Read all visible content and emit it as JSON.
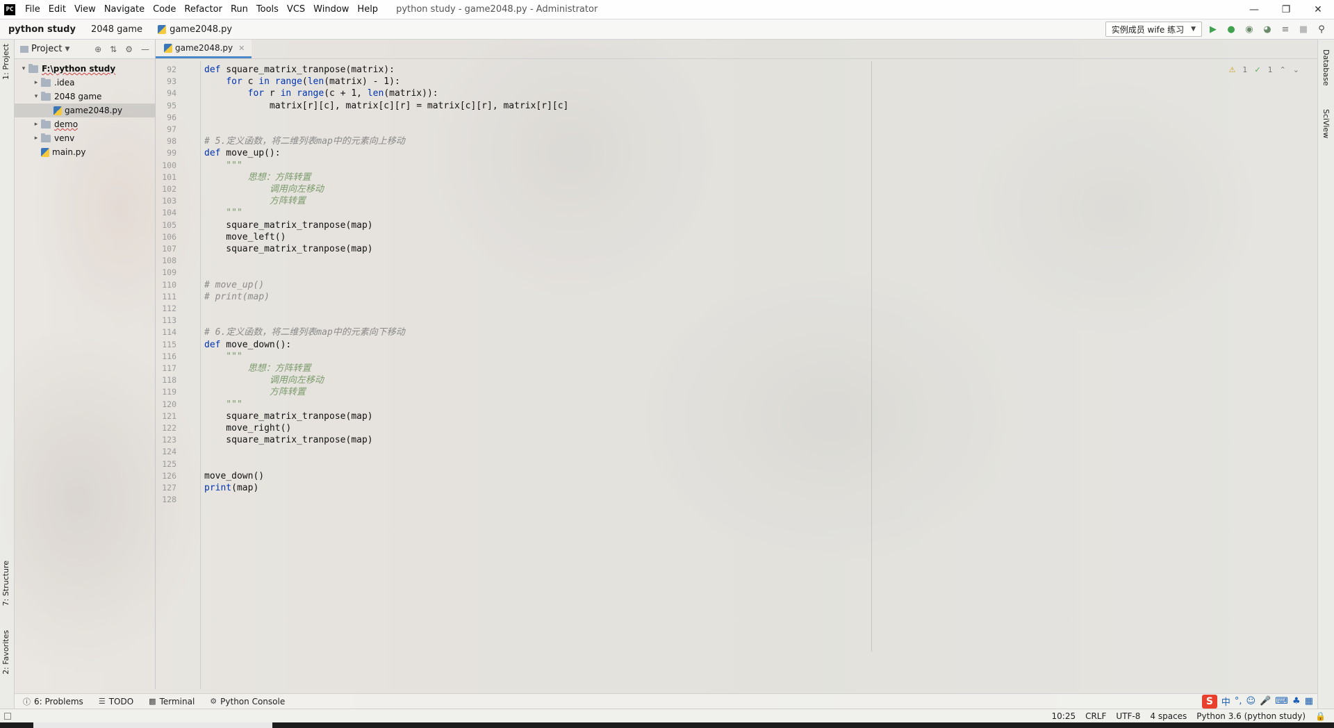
{
  "window": {
    "logo": "PC",
    "title": "python study - game2048.py - Administrator",
    "menu": [
      "File",
      "Edit",
      "View",
      "Navigate",
      "Code",
      "Refactor",
      "Run",
      "Tools",
      "VCS",
      "Window",
      "Help"
    ]
  },
  "navbar": {
    "crumbs": [
      "python study",
      "2048 game",
      "game2048.py"
    ],
    "run_config": "实例成员 wife 练习"
  },
  "left_tabs": {
    "project": "1: Project",
    "structure": "7: Structure",
    "favorites": "2: Favorites"
  },
  "project_panel": {
    "title": "Project",
    "tree": [
      {
        "label": "F:\\python study",
        "level": 0,
        "type": "folder",
        "expanded": true,
        "bold": true
      },
      {
        "label": ".idea",
        "level": 1,
        "type": "folder",
        "expanded": false
      },
      {
        "label": "2048 game",
        "level": 1,
        "type": "folder",
        "expanded": true
      },
      {
        "label": "game2048.py",
        "level": 2,
        "type": "py",
        "selected": true
      },
      {
        "label": "demo",
        "level": 1,
        "type": "folder",
        "expanded": false,
        "underline": true
      },
      {
        "label": "venv",
        "level": 1,
        "type": "folder",
        "expanded": false
      },
      {
        "label": "main.py",
        "level": 1,
        "type": "py"
      }
    ]
  },
  "editor": {
    "tab": "game2048.py",
    "inspection": {
      "warnings": "1",
      "ok": "1"
    },
    "lines": [
      {
        "n": "92",
        "t": "def square_matrix_tranpose(matrix):",
        "k": "code"
      },
      {
        "n": "93",
        "t": "    for c in range(len(matrix) - 1):",
        "k": "code"
      },
      {
        "n": "94",
        "t": "        for r in range(c + 1, len(matrix)):",
        "k": "code"
      },
      {
        "n": "95",
        "t": "            matrix[r][c], matrix[c][r] = matrix[c][r], matrix[r][c]",
        "k": "code"
      },
      {
        "n": "96",
        "t": "",
        "k": "code"
      },
      {
        "n": "97",
        "t": "",
        "k": "code"
      },
      {
        "n": "98",
        "t": "# 5.定义函数，将二维列表map中的元素向上移动",
        "k": "comment"
      },
      {
        "n": "99",
        "t": "def move_up():",
        "k": "code"
      },
      {
        "n": "100",
        "t": "    \"\"\"",
        "k": "docstr"
      },
      {
        "n": "101",
        "t": "        思想：方阵转置",
        "k": "docstr"
      },
      {
        "n": "102",
        "t": "            调用向左移动",
        "k": "docstr"
      },
      {
        "n": "103",
        "t": "            方阵转置",
        "k": "docstr"
      },
      {
        "n": "104",
        "t": "    \"\"\"",
        "k": "docstr"
      },
      {
        "n": "105",
        "t": "    square_matrix_tranpose(map)",
        "k": "code"
      },
      {
        "n": "106",
        "t": "    move_left()",
        "k": "code"
      },
      {
        "n": "107",
        "t": "    square_matrix_tranpose(map)",
        "k": "code"
      },
      {
        "n": "108",
        "t": "",
        "k": "code"
      },
      {
        "n": "109",
        "t": "",
        "k": "code"
      },
      {
        "n": "110",
        "t": "# move_up()",
        "k": "comment"
      },
      {
        "n": "111",
        "t": "# print(map)",
        "k": "comment"
      },
      {
        "n": "112",
        "t": "",
        "k": "code"
      },
      {
        "n": "113",
        "t": "",
        "k": "code"
      },
      {
        "n": "114",
        "t": "# 6.定义函数，将二维列表map中的元素向下移动",
        "k": "comment"
      },
      {
        "n": "115",
        "t": "def move_down():",
        "k": "code"
      },
      {
        "n": "116",
        "t": "    \"\"\"",
        "k": "docstr"
      },
      {
        "n": "117",
        "t": "        思想：方阵转置",
        "k": "docstr"
      },
      {
        "n": "118",
        "t": "            调用向左移动",
        "k": "docstr"
      },
      {
        "n": "119",
        "t": "            方阵转置",
        "k": "docstr"
      },
      {
        "n": "120",
        "t": "    \"\"\"",
        "k": "docstr"
      },
      {
        "n": "121",
        "t": "    square_matrix_tranpose(map)",
        "k": "code"
      },
      {
        "n": "122",
        "t": "    move_right()",
        "k": "code"
      },
      {
        "n": "123",
        "t": "    square_matrix_tranpose(map)",
        "k": "code"
      },
      {
        "n": "124",
        "t": "",
        "k": "code"
      },
      {
        "n": "125",
        "t": "",
        "k": "code"
      },
      {
        "n": "126",
        "t": "move_down()",
        "k": "code"
      },
      {
        "n": "127",
        "t": "print(map)",
        "k": "code"
      },
      {
        "n": "128",
        "t": "",
        "k": "code"
      }
    ]
  },
  "right_tabs": {
    "database": "Database",
    "sciview": "SciView"
  },
  "bottom_tools": {
    "problems": "6: Problems",
    "todo": "TODO",
    "terminal": "Terminal",
    "console": "Python Console",
    "ime_logo": "S",
    "ime_lang": "中"
  },
  "status": {
    "position": "10:25",
    "line_sep": "CRLF",
    "encoding": "UTF-8",
    "indent": "4 spaces",
    "interpreter": "Python 3.6 (python study)"
  }
}
